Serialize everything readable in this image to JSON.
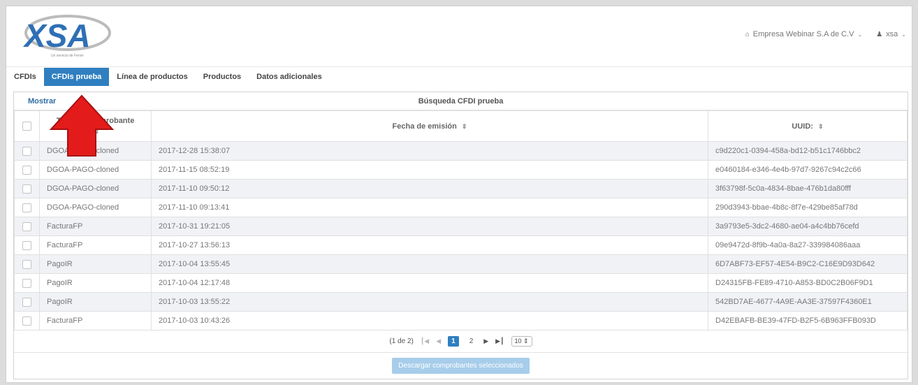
{
  "brand": {
    "logo_text": "XSA",
    "logo_tagline": "Un servicio de Ferrer",
    "colors": {
      "logo_blue": "#2f6fb5",
      "logo_gray": "#8a8a8a"
    }
  },
  "header": {
    "company": {
      "icon": "building-icon",
      "label": "Empresa Webinar S.A de C.V"
    },
    "user": {
      "icon": "user-icon",
      "label": "xsa"
    }
  },
  "tabs": [
    {
      "label": "CFDIs",
      "active": false
    },
    {
      "label": "CFDIs prueba",
      "active": true
    },
    {
      "label": "Línea de productos",
      "active": false
    },
    {
      "label": "Productos",
      "active": false
    },
    {
      "label": "Datos adicionales",
      "active": false
    }
  ],
  "panel": {
    "show_link": "Mostrar",
    "title": "Búsqueda CFDI prueba",
    "columns": {
      "tipo": "Tipo de comprobante",
      "fecha": "Fecha de emisión",
      "uuid": "UUID:"
    },
    "rows": [
      {
        "tipo": "DGOA-PAGO-cloned",
        "fecha": "2017-12-28 15:38:07",
        "uuid": "c9d220c1-0394-458a-bd12-b51c1746bbc2"
      },
      {
        "tipo": "DGOA-PAGO-cloned",
        "fecha": "2017-11-15 08:52:19",
        "uuid": "e0460184-e346-4e4b-97d7-9267c94c2c66"
      },
      {
        "tipo": "DGOA-PAGO-cloned",
        "fecha": "2017-11-10 09:50:12",
        "uuid": "3f63798f-5c0a-4834-8bae-476b1da80fff"
      },
      {
        "tipo": "DGOA-PAGO-cloned",
        "fecha": "2017-11-10 09:13:41",
        "uuid": "290d3943-bbae-4b8c-8f7e-429be85af78d"
      },
      {
        "tipo": "FacturaFP",
        "fecha": "2017-10-31 19:21:05",
        "uuid": "3a9793e5-3dc2-4680-ae04-a4c4bb76cefd"
      },
      {
        "tipo": "FacturaFP",
        "fecha": "2017-10-27 13:56:13",
        "uuid": "09e9472d-8f9b-4a0a-8a27-339984086aaa"
      },
      {
        "tipo": "PagoIR",
        "fecha": "2017-10-04 13:55:45",
        "uuid": "6D7ABF73-EF57-4E54-B9C2-C16E9D93D642"
      },
      {
        "tipo": "PagoIR",
        "fecha": "2017-10-04 12:17:48",
        "uuid": "D24315FB-FE89-4710-A853-BD0C2B06F9D1"
      },
      {
        "tipo": "PagoIR",
        "fecha": "2017-10-03 13:55:22",
        "uuid": "542BD7AE-4677-4A9E-AA3E-37597F4360E1"
      },
      {
        "tipo": "FacturaFP",
        "fecha": "2017-10-03 10:43:26",
        "uuid": "D42EBAFB-BE39-47FD-B2F5-6B963FFB093D"
      }
    ]
  },
  "pagination": {
    "summary": "(1 de 2)",
    "pages": [
      "1",
      "2"
    ],
    "current_page": "1",
    "rows_per_page": "10"
  },
  "actions": {
    "download_label": "Descargar comprobantes seleccionados"
  },
  "annotation": {
    "arrow_color": "#e41b1b"
  }
}
